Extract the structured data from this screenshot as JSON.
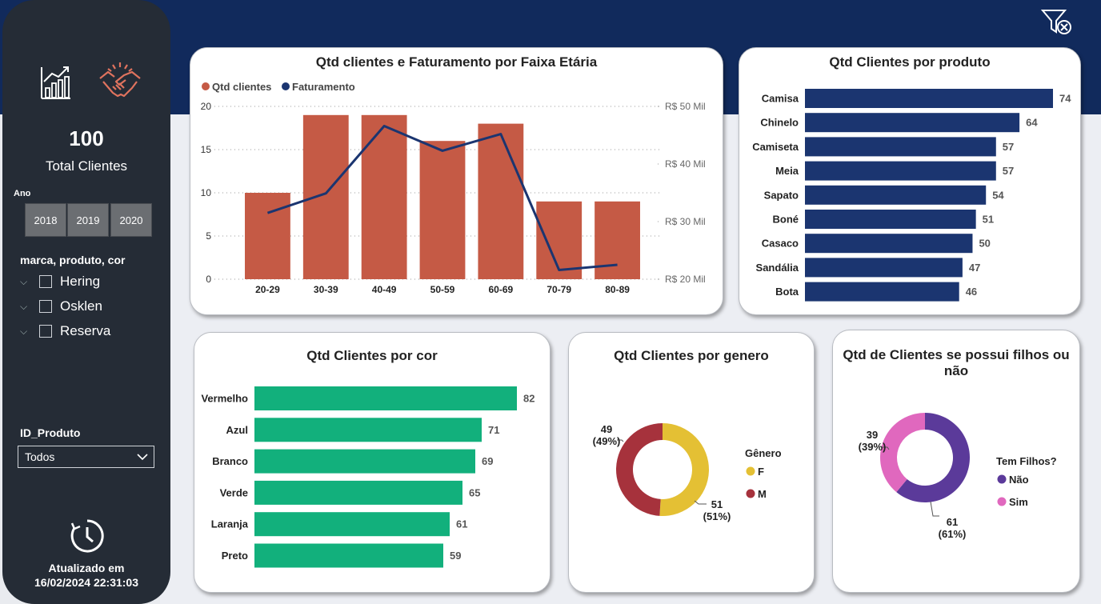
{
  "sidebar": {
    "kpi_value": "100",
    "kpi_label": "Total Clientes",
    "year_slicer": {
      "label": "Ano",
      "years": [
        "2018",
        "2019",
        "2020"
      ]
    },
    "tree_slicer": {
      "label": "marca, produto, cor",
      "items": [
        "Hering",
        "Osklen",
        "Reserva"
      ]
    },
    "id_produto": {
      "label": "ID_Produto",
      "value": "Todos"
    },
    "updated": {
      "label": "Atualizado em",
      "timestamp": "16/02/2024 22:31:03"
    }
  },
  "colors": {
    "navy": "#112a5c",
    "sidebar": "#252c36",
    "bar_red": "#c55a45",
    "bar_navy": "#1b3570",
    "bar_green": "#12b07c",
    "donut_yellow": "#e4c034",
    "donut_red": "#a6323c",
    "donut_purple": "#5b3a9a",
    "donut_pink": "#e068be"
  },
  "chart_data": [
    {
      "type": "bar",
      "title": "Qtd clientes e Faturamento por Faixa Etária",
      "categories": [
        "20-29",
        "30-39",
        "40-49",
        "50-59",
        "60-69",
        "70-79",
        "80-89"
      ],
      "series": [
        {
          "name": "Qtd clientes",
          "type": "bar",
          "values": [
            10,
            19,
            19,
            16,
            18,
            9,
            9
          ]
        },
        {
          "name": "Faturamento",
          "type": "line",
          "values": [
            31500,
            34900,
            46600,
            42300,
            45200,
            21600,
            22500
          ]
        }
      ],
      "ylim": [
        0,
        20
      ],
      "yticks": [
        "0",
        "5",
        "10",
        "15",
        "20"
      ],
      "y2lim": [
        20000,
        50000
      ],
      "y2ticks": [
        "R$ 20 Mil",
        "R$ 30 Mil",
        "R$ 40 Mil",
        "R$ 50 Mil"
      ],
      "legend": "top-left"
    },
    {
      "type": "bar",
      "title": "Qtd Clientes por produto",
      "categories": [
        "Camisa",
        "Chinelo",
        "Camiseta",
        "Meia",
        "Sapato",
        "Boné",
        "Casaco",
        "Sandália",
        "Bota"
      ],
      "values": [
        74,
        64,
        57,
        57,
        54,
        51,
        50,
        47,
        46
      ]
    },
    {
      "type": "bar",
      "title": "Qtd Clientes por cor",
      "categories": [
        "Vermelho",
        "Azul",
        "Branco",
        "Verde",
        "Laranja",
        "Preto"
      ],
      "values": [
        82,
        71,
        69,
        65,
        61,
        59
      ]
    },
    {
      "type": "pie",
      "title": "Qtd Clientes por genero",
      "legend_title": "Gênero",
      "categories": [
        "F",
        "M"
      ],
      "values": [
        51,
        49
      ],
      "percents": [
        "(51%)",
        "(49%)"
      ]
    },
    {
      "type": "pie",
      "title": "Qtd de Clientes se possui filhos ou não",
      "legend_title": "Tem Filhos?",
      "categories": [
        "Não",
        "Sim"
      ],
      "values": [
        61,
        39
      ],
      "percents": [
        "(61%)",
        "(39%)"
      ]
    }
  ]
}
